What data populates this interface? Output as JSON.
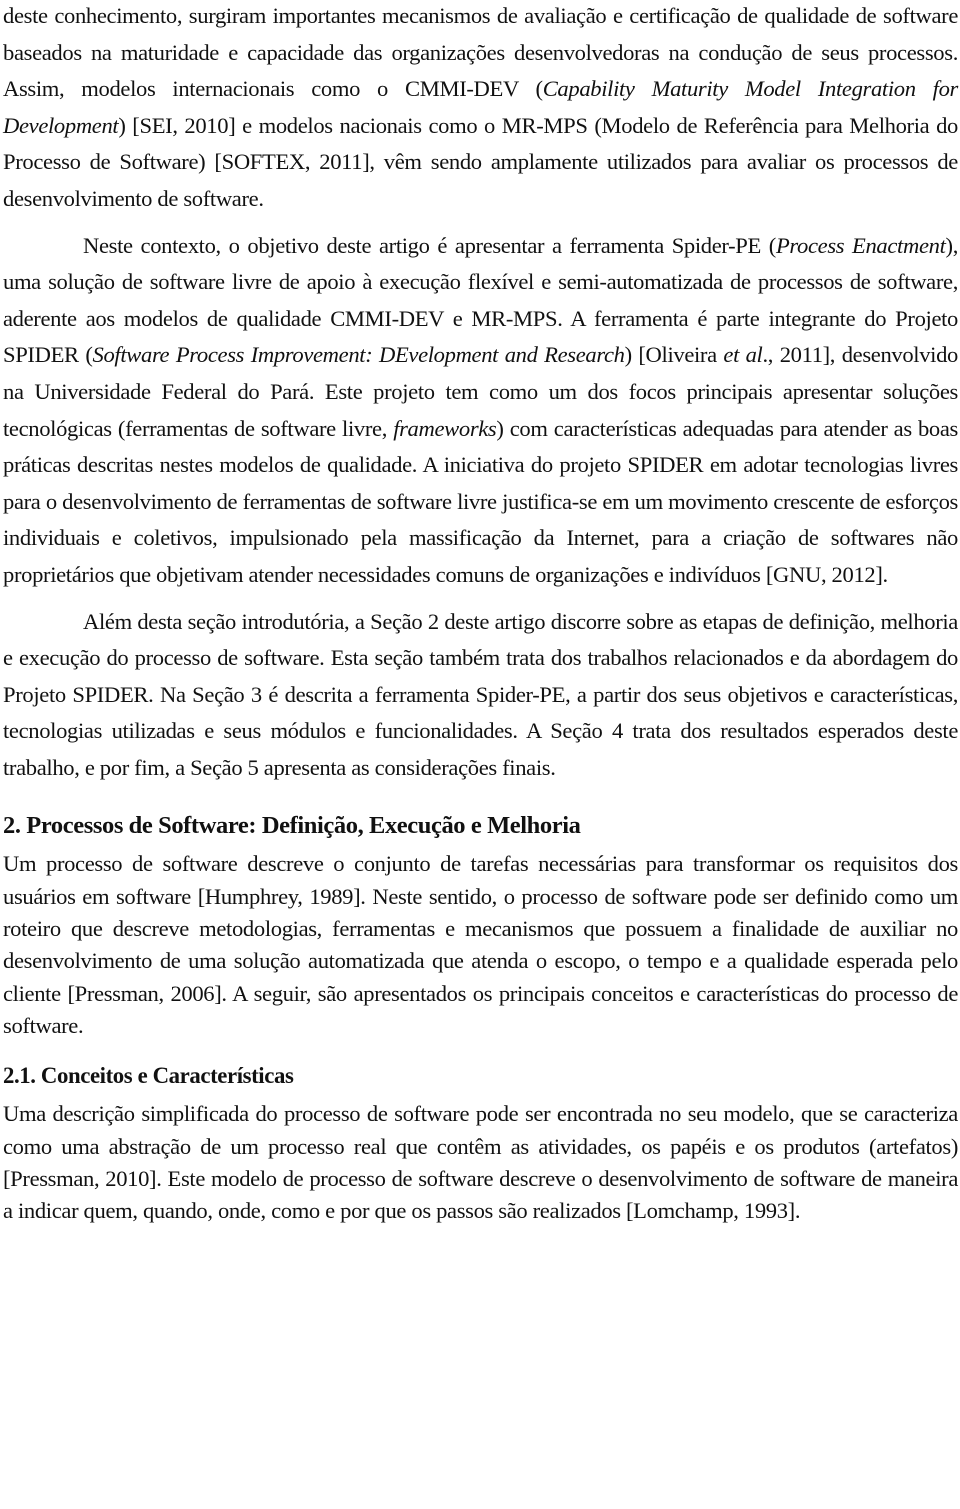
{
  "document": {
    "paragraphs": [
      {
        "id": "intro-continuation",
        "indent": false,
        "segments": [
          {
            "text": "deste conhecimento, surgiram importantes mecanismos de avaliação e certificação de qualidade de software baseados na maturidade e capacidade das organizações desenvolvedoras na condução de seus processos. Assim, modelos internacionais como o CMMI-DEV (",
            "italic": false
          },
          {
            "text": "Capability Maturity Model Integration for Development",
            "italic": true
          },
          {
            "text": ") [SEI, 2010] e modelos nacionais como o MR-MPS (Modelo de Referência para Melhoria do Processo de Software) [SOFTEX, 2011], vêm sendo amplamente utilizados para avaliar os processos de desenvolvimento de software.",
            "italic": false
          }
        ]
      },
      {
        "id": "objective",
        "indent": true,
        "segments": [
          {
            "text": "Neste contexto, o objetivo deste artigo é apresentar a ferramenta Spider-PE (",
            "italic": false
          },
          {
            "text": "Process Enactment",
            "italic": true
          },
          {
            "text": "), uma solução de software livre de apoio à execução flexível e semi-automatizada de processos de software, aderente aos modelos de qualidade CMMI-DEV e MR-MPS. A ferramenta é parte integrante do Projeto SPIDER (",
            "italic": false
          },
          {
            "text": "Software Process Improvement: DEvelopment and Research",
            "italic": true
          },
          {
            "text": ") [Oliveira ",
            "italic": false
          },
          {
            "text": "et al",
            "italic": true
          },
          {
            "text": "., 2011], desenvolvido na Universidade Federal do Pará. Este projeto tem como um dos focos principais apresentar soluções tecnológicas (ferramentas de software livre, ",
            "italic": false
          },
          {
            "text": "frameworks",
            "italic": true
          },
          {
            "text": ") com características adequadas para atender as boas práticas descritas nestes modelos de qualidade. A iniciativa do projeto SPIDER em adotar tecnologias livres para o desenvolvimento de ferramentas de software livre justifica-se em um movimento crescente de esforços individuais e coletivos, impulsionado pela massificação da Internet, para a criação de softwares não proprietários que objetivam atender necessidades comuns de organizações e indivíduos [GNU, 2012].",
            "italic": false
          }
        ]
      },
      {
        "id": "structure",
        "indent": true,
        "segments": [
          {
            "text": "Além desta seção introdutória, a Seção 2 deste artigo discorre sobre as etapas de definição, melhoria e execução do processo de software. Esta seção também trata dos trabalhos relacionados e da abordagem do Projeto SPIDER. Na Seção 3 é descrita a ferramenta Spider-PE, a partir dos seus objetivos e características, tecnologias utilizadas e seus módulos e funcionalidades. A Seção 4 trata dos resultados esperados deste trabalho, e por fim, a Seção 5 apresenta as considerações finais.",
            "italic": false
          }
        ]
      }
    ],
    "section_2": {
      "heading": "2. Processos de Software: Definição, Execução e Melhoria",
      "paragraph": "Um processo de software descreve o conjunto de tarefas necessárias para transformar os requisitos dos usuários em software [Humphrey, 1989]. Neste sentido, o processo de software pode ser definido como um roteiro que descreve metodologias, ferramentas e mecanismos que possuem a finalidade de auxiliar no desenvolvimento de uma solução automatizada que atenda o escopo, o tempo e a qualidade esperada pelo cliente [Pressman, 2006]. A seguir, são apresentados os principais conceitos e características do processo de software."
    },
    "section_2_1": {
      "heading": "2.1. Conceitos e Características",
      "paragraph": "Uma descrição simplificada do processo de software pode ser encontrada no seu modelo, que se caracteriza como uma abstração de um processo real que contêm as atividades, os papéis e os produtos (artefatos) [Pressman, 2010]. Este modelo de processo de software descreve o desenvolvimento de software de maneira a indicar quem, quando, onde, como e por que os passos são realizados [Lomchamp, 1993]."
    }
  }
}
